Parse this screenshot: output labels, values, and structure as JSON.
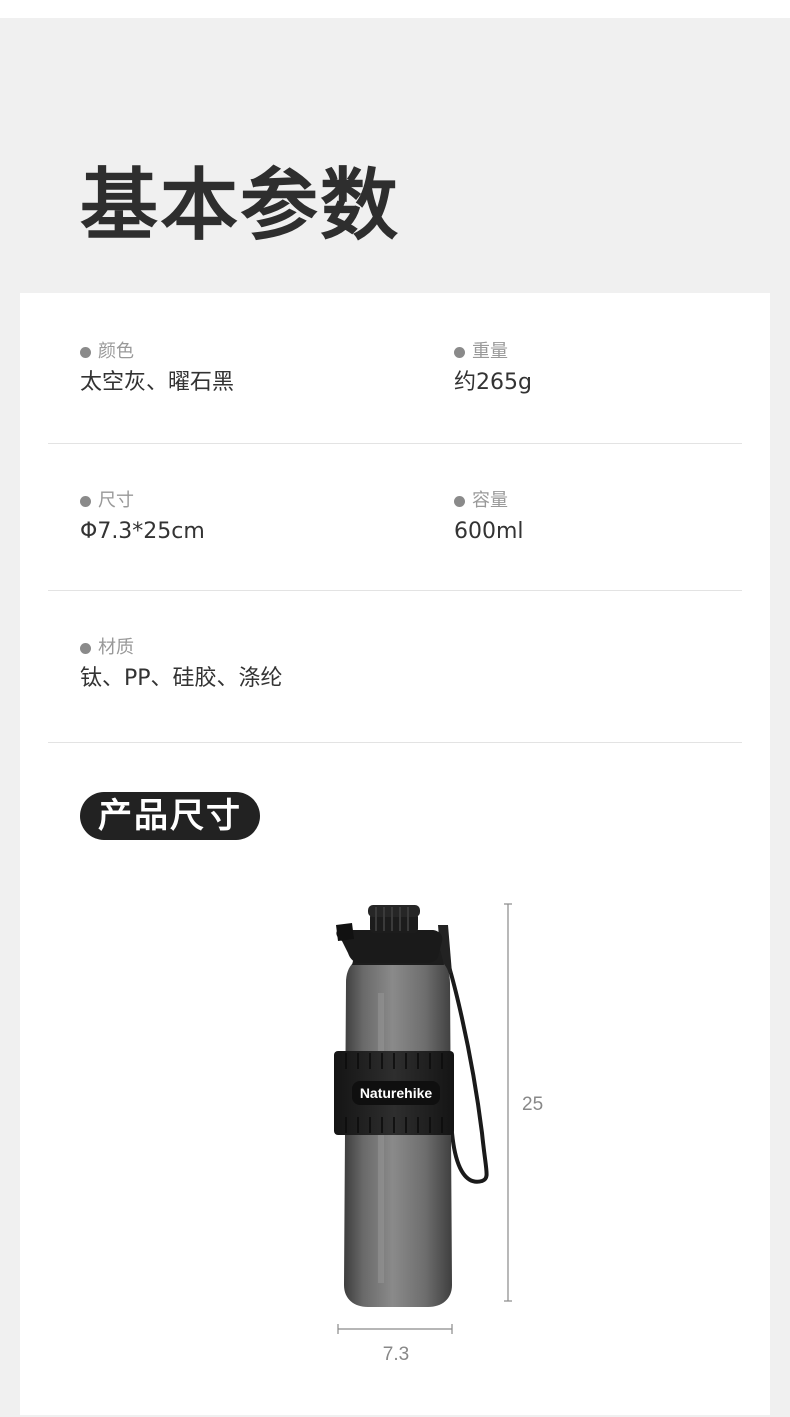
{
  "page": {
    "title": "基本参数"
  },
  "specs": [
    {
      "label": "颜色",
      "value": "太空灰、曜石黑"
    },
    {
      "label": "重量",
      "value": "约265g"
    },
    {
      "label": "尺寸",
      "value": "Φ7.3*25cm"
    },
    {
      "label": "容量",
      "value": "600ml"
    },
    {
      "label": "材质",
      "value": "钛、PP、硅胶、涤纶"
    }
  ],
  "product_size": {
    "heading": "产品尺寸",
    "brand": "Naturehike",
    "height_label": "25",
    "width_label": "7.3"
  },
  "colors": {
    "page_bg": "#f0f0f0",
    "card_bg": "#ffffff",
    "title_text": "#2e2e2e",
    "badge_bg": "#222222",
    "bottle_body": "#5f5f5f",
    "cap": "#1c1c1c"
  }
}
